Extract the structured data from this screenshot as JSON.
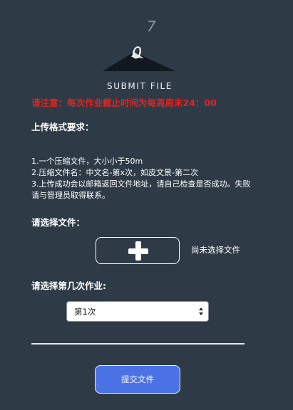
{
  "header": {
    "title": "SUBMIT FILE",
    "logo_icon": "submit-file-logo",
    "logo_char_small": "7",
    "logo_char_large": "0"
  },
  "notice": "请注意：每次作业截止时间为每周周末24：00",
  "requirements": {
    "heading": "上传格式要求：",
    "items": [
      "1.一个压缩文件，大小小于50m",
      "2.压缩文件名：中文名-第x次，如皮文景-第二次",
      "3.上传成功会以邮箱返回文件地址，请自己检查是否成功。失败请与管理员取得联系。"
    ]
  },
  "file_picker": {
    "heading": "请选择文件：",
    "button_icon": "plus-icon",
    "status": "尚未选择文件"
  },
  "assignment": {
    "heading": "请选择第几次作业:",
    "selected": "第1次"
  },
  "submit": {
    "label": "提交文件"
  },
  "colors": {
    "background": "#2e3a46",
    "notice": "#e0241f",
    "submit_button": "#4a72e4"
  }
}
